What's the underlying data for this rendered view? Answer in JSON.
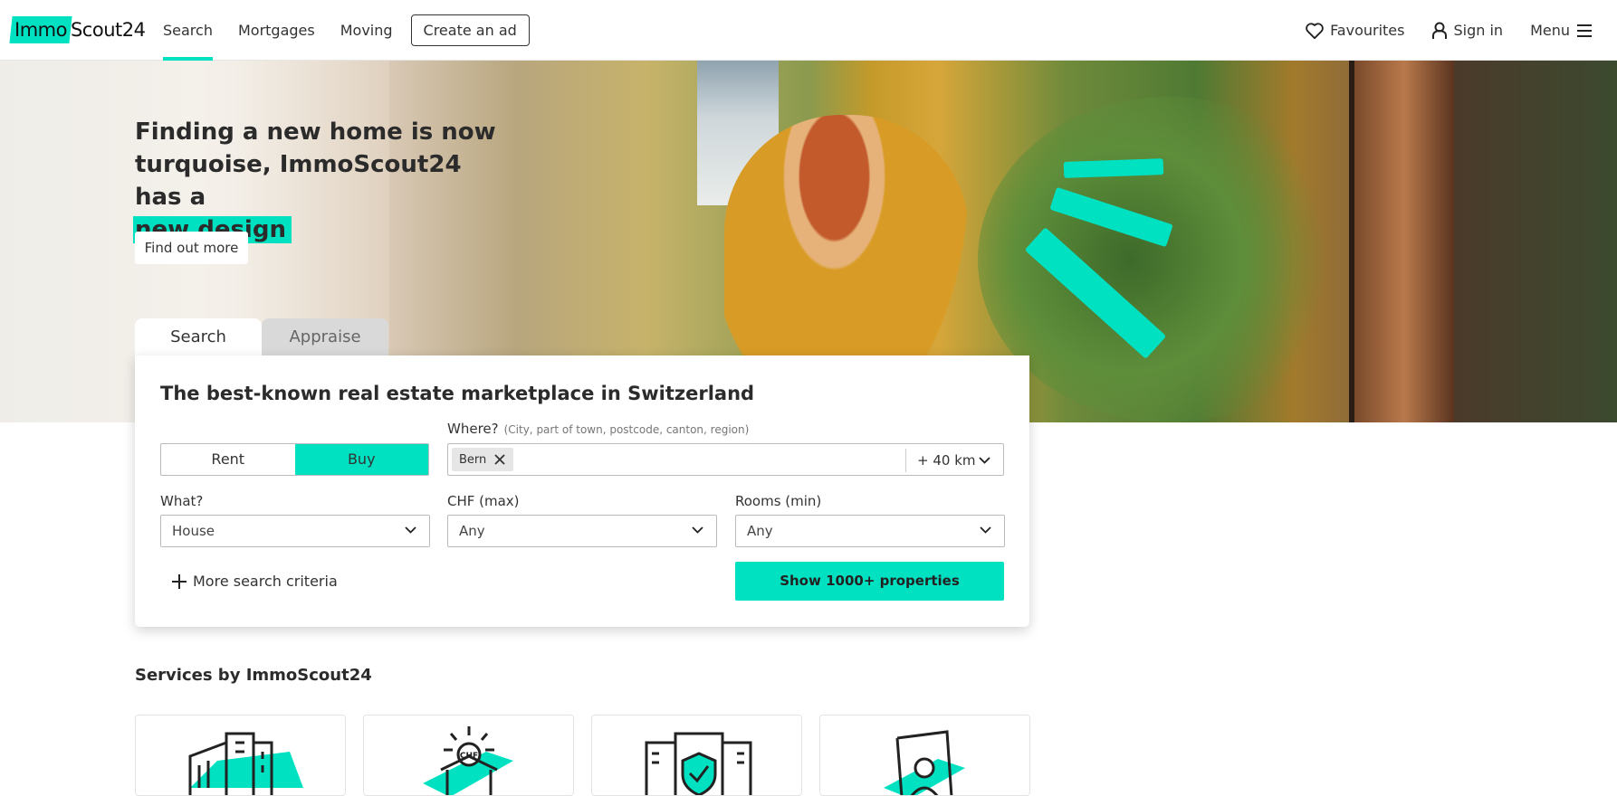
{
  "header": {
    "logo_part1": "Immo",
    "logo_part2": "Scout24",
    "nav": [
      "Search",
      "Mortgages",
      "Moving"
    ],
    "create_ad": "Create an ad",
    "favourites": "Favourites",
    "sign_in": "Sign in",
    "menu": "Menu"
  },
  "hero": {
    "title_line1": "Finding a new home is now",
    "title_line2": "turquoise, ImmoScout24 has a",
    "title_highlight": "new design",
    "cta": "Find out more"
  },
  "search": {
    "tabs": [
      "Search",
      "Appraise"
    ],
    "title": "The best-known real estate marketplace in Switzerland",
    "rent": "Rent",
    "buy": "Buy",
    "where_label": "Where?",
    "where_hint": "(City, part of town, postcode, canton, region)",
    "location_chip": "Bern",
    "radius": "+ 40 km",
    "what_label": "What?",
    "what_value": "House",
    "price_label": "CHF (max)",
    "price_value": "Any",
    "rooms_label": "Rooms (min)",
    "rooms_value": "Any",
    "more_criteria": "More search criteria",
    "show_button": "Show 1000+ properties"
  },
  "services": {
    "title": "Services by ImmoScout24"
  },
  "colors": {
    "accent": "#00e1c1",
    "text": "#333333"
  }
}
